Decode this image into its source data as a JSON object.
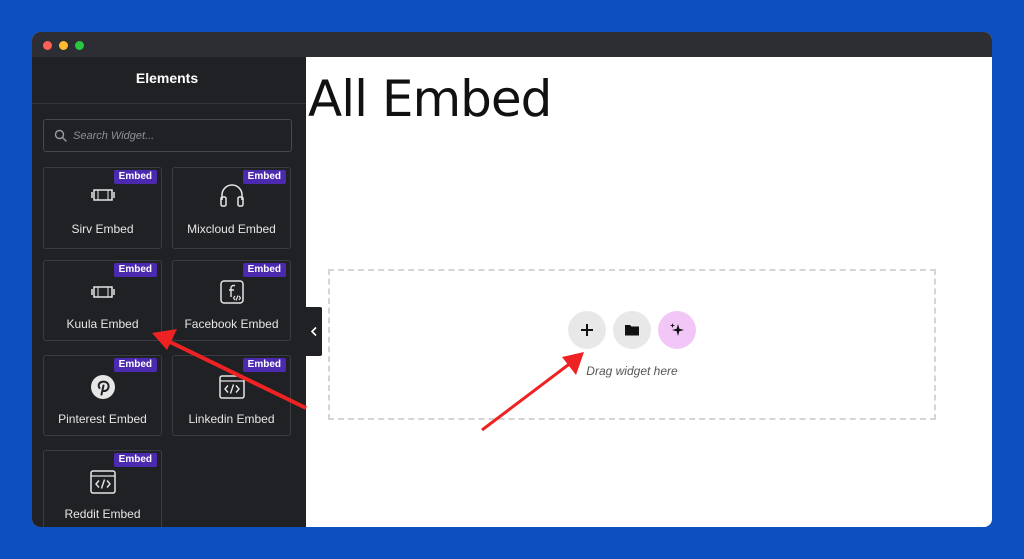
{
  "sidebar": {
    "title": "Elements",
    "search_placeholder": "Search Widget..."
  },
  "widgets": [
    {
      "label": "Sirv Embed",
      "badge": "Embed",
      "icon": "sirv-icon"
    },
    {
      "label": "Mixcloud Embed",
      "badge": "Embed",
      "icon": "headphones-icon"
    },
    {
      "label": "Kuula Embed",
      "badge": "Embed",
      "icon": "kuula-icon"
    },
    {
      "label": "Facebook Embed",
      "badge": "Embed",
      "icon": "facebook-embed-icon"
    },
    {
      "label": "Pinterest Embed",
      "badge": "Embed",
      "icon": "pinterest-icon"
    },
    {
      "label": "Linkedin Embed",
      "badge": "Embed",
      "icon": "code-window-icon"
    },
    {
      "label": "Reddit Embed",
      "badge": "Embed",
      "icon": "code-window-icon"
    }
  ],
  "canvas": {
    "page_title": "All Embed",
    "drop_hint": "Drag widget here"
  },
  "colors": {
    "background": "#0b4fc0",
    "sidebar": "#202124",
    "badge": "#4b2ab0",
    "ai_button": "#f2c6f7",
    "annotation_arrow": "#ee2222"
  }
}
